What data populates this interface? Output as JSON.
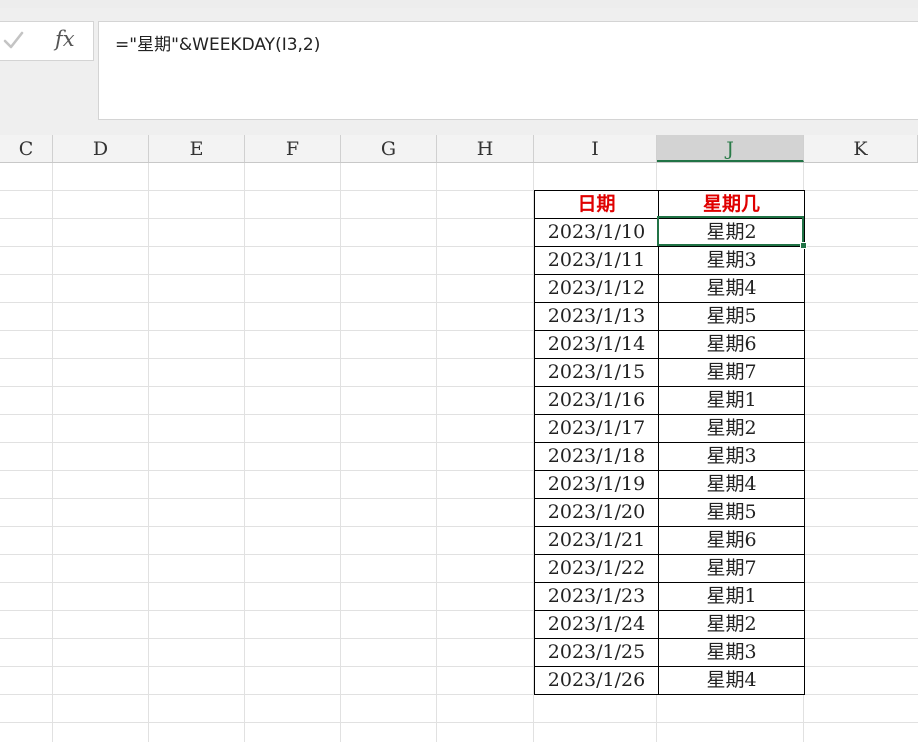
{
  "formula_bar": {
    "formula": "=\"星期\"&WEEKDAY(I3,2)",
    "check_icon": "check-icon",
    "fx_label": "fx"
  },
  "columns": [
    {
      "label": "C",
      "selected": false
    },
    {
      "label": "D",
      "selected": false
    },
    {
      "label": "E",
      "selected": false
    },
    {
      "label": "F",
      "selected": false
    },
    {
      "label": "G",
      "selected": false
    },
    {
      "label": "H",
      "selected": false
    },
    {
      "label": "I",
      "selected": false
    },
    {
      "label": "J",
      "selected": true
    },
    {
      "label": "K",
      "selected": false
    }
  ],
  "table": {
    "headers": [
      "日期",
      "星期几"
    ],
    "header_color": "#e00000",
    "rows": [
      [
        "2023/1/10",
        "星期2"
      ],
      [
        "2023/1/11",
        "星期3"
      ],
      [
        "2023/1/12",
        "星期4"
      ],
      [
        "2023/1/13",
        "星期5"
      ],
      [
        "2023/1/14",
        "星期6"
      ],
      [
        "2023/1/15",
        "星期7"
      ],
      [
        "2023/1/16",
        "星期1"
      ],
      [
        "2023/1/17",
        "星期2"
      ],
      [
        "2023/1/18",
        "星期3"
      ],
      [
        "2023/1/19",
        "星期4"
      ],
      [
        "2023/1/20",
        "星期5"
      ],
      [
        "2023/1/21",
        "星期6"
      ],
      [
        "2023/1/22",
        "星期7"
      ],
      [
        "2023/1/23",
        "星期1"
      ],
      [
        "2023/1/24",
        "星期2"
      ],
      [
        "2023/1/25",
        "星期3"
      ],
      [
        "2023/1/26",
        "星期4"
      ]
    ]
  },
  "active_cell": {
    "column": "J",
    "row_index": 0
  },
  "selection_color": "#217346"
}
